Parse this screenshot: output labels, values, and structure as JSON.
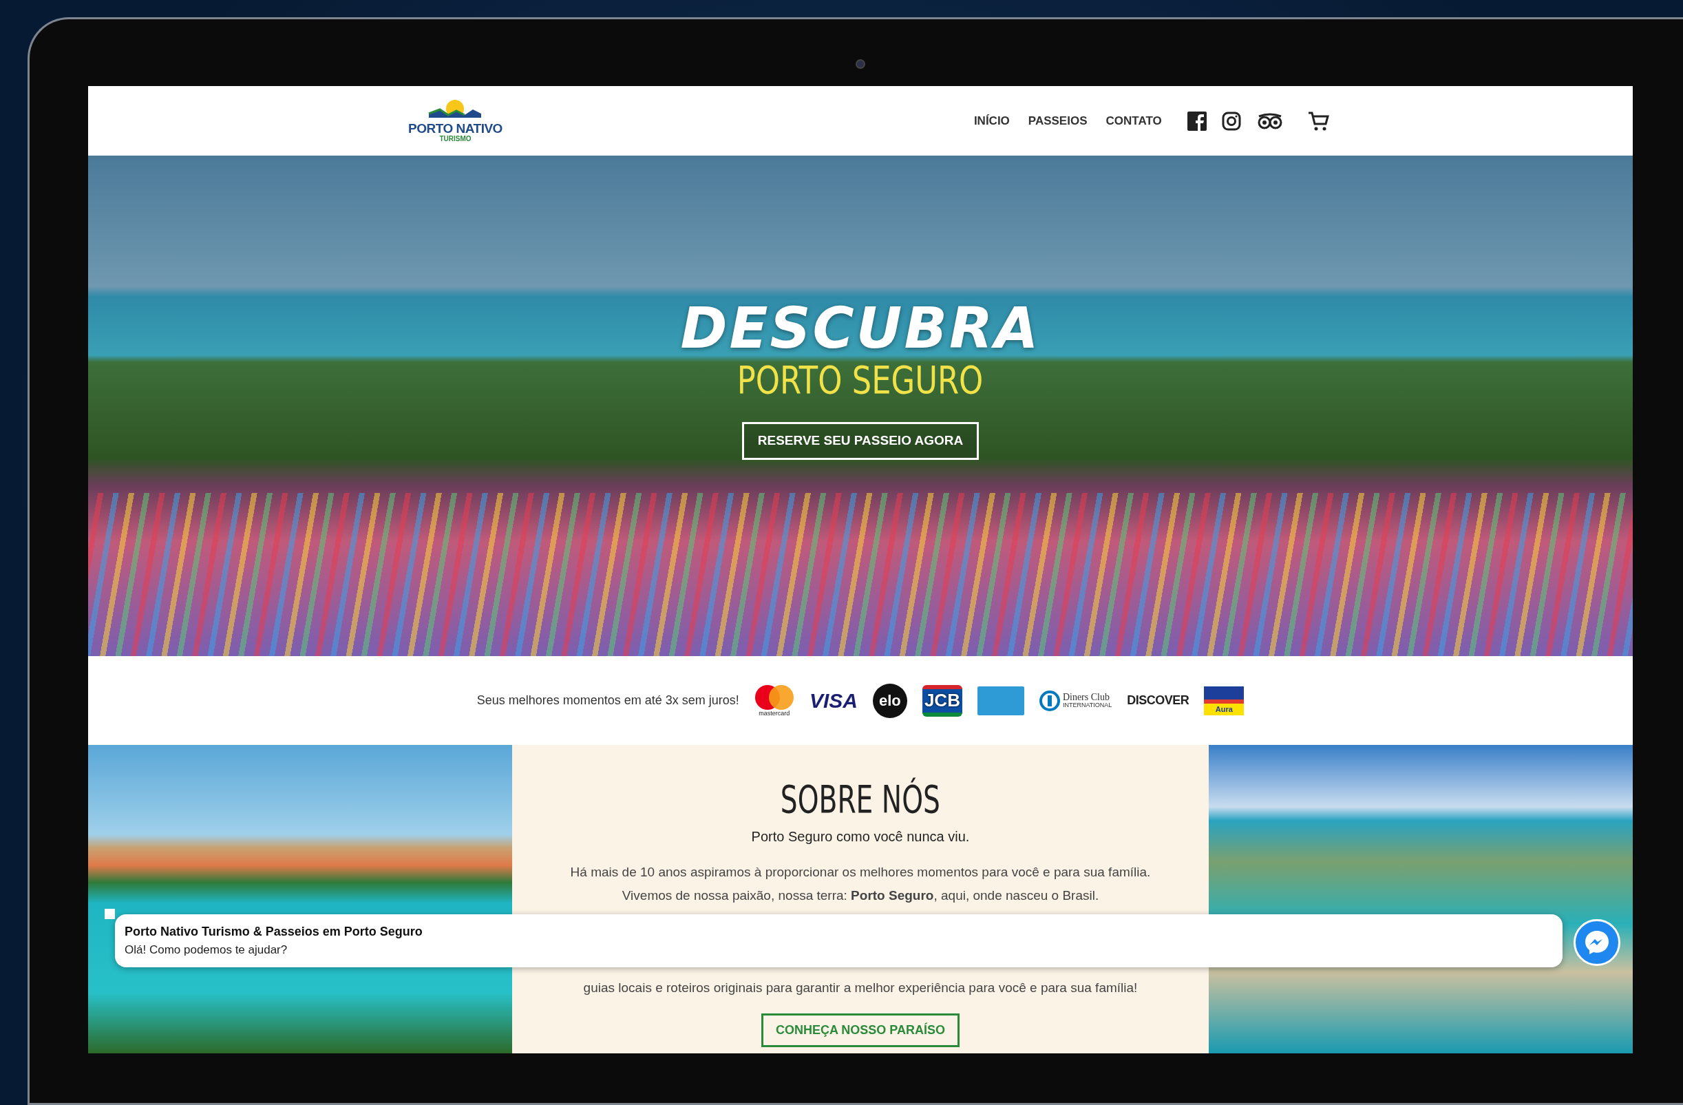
{
  "nav": {
    "logo": {
      "title": "PORTO NATIVO",
      "subtitle": "TURISMO"
    },
    "links": [
      {
        "label": "INÍCIO"
      },
      {
        "label": "PASSEIOS"
      },
      {
        "label": "CONTATO"
      }
    ],
    "icons": [
      {
        "kind": "facebook"
      },
      {
        "kind": "instagram"
      },
      {
        "kind": "owl"
      },
      {
        "kind": "cart"
      }
    ]
  },
  "hero": {
    "title": "DESCUBRA",
    "subtitle": "PORTO SEGURO",
    "button": "RESERVE SEU PASSEIO AGORA"
  },
  "payments": {
    "text": "Seus melhores momentos em até 3x sem juros!",
    "cards": [
      {
        "kind": "mastercard",
        "label": "mastercard"
      },
      {
        "kind": "visa",
        "label": "VISA"
      },
      {
        "kind": "elo",
        "label": "elo"
      },
      {
        "kind": "jcb",
        "label": "JCB"
      },
      {
        "kind": "amex"
      },
      {
        "kind": "diners",
        "label": "Diners Club",
        "sublabel": "INTERNATIONAL"
      },
      {
        "kind": "discover",
        "label": "DISCOVER"
      },
      {
        "kind": "aura",
        "label": "Aura"
      }
    ]
  },
  "about": {
    "heading": "SOBRE NÓS",
    "tagline": "Porto Seguro como você nunca viu.",
    "lines": [
      "Há mais de 10 anos aspiramos à proporcionar os melhores momentos para você e para sua família.",
      "Vivemos de nossa paixão, nossa terra: **Porto Seguro**, aqui, onde nasceu o Brasil.",
      "guias locais e roteiros originais para garantir a melhor experiência para você e para sua família!"
    ],
    "button": "CONHEÇA NOSSO PARAÍSO"
  },
  "chat": {
    "title": "Porto Nativo Turismo & Passeios em Porto Seguro",
    "message": "Olá! Como podemos te ajudar?"
  }
}
